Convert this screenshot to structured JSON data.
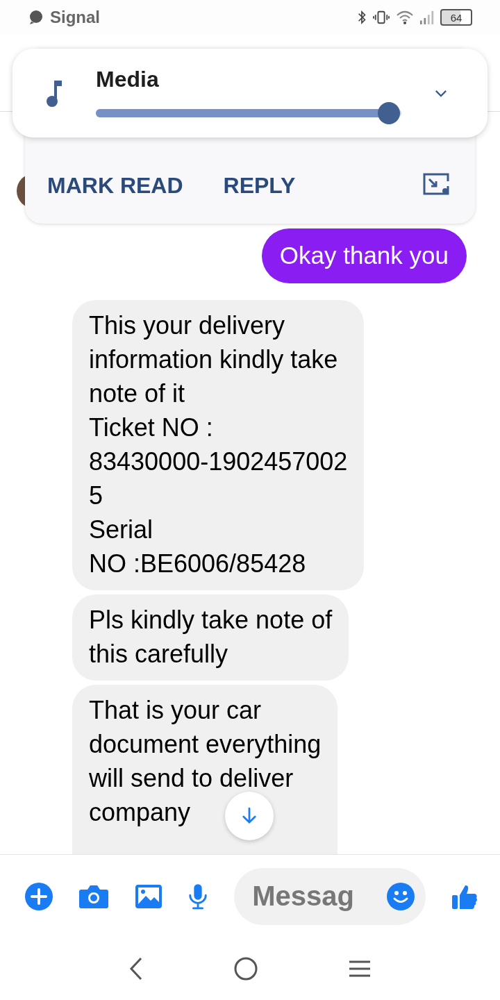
{
  "status_bar": {
    "app_name": "Signal",
    "battery": "64"
  },
  "media_panel": {
    "title": "Media",
    "level": 0.96
  },
  "notification": {
    "actions": [
      "MARK READ",
      "REPLY"
    ]
  },
  "messages": [
    {
      "text": "Okay thank you",
      "outgoing": true
    },
    {
      "text": "This your delivery\ninformation kindly take\nnote of it\nTicket NO :\n83430000-1902457002\n5\nSerial\nNO :BE6006/85428",
      "outgoing": false
    },
    {
      "text": "Pls kindly take note of\nthis carefully",
      "outgoing": false
    },
    {
      "text": "That is your car\ndocument everything\nwill send to deliver\ncompany",
      "outgoing": false
    }
  ],
  "composer": {
    "placeholder": "Messag"
  }
}
